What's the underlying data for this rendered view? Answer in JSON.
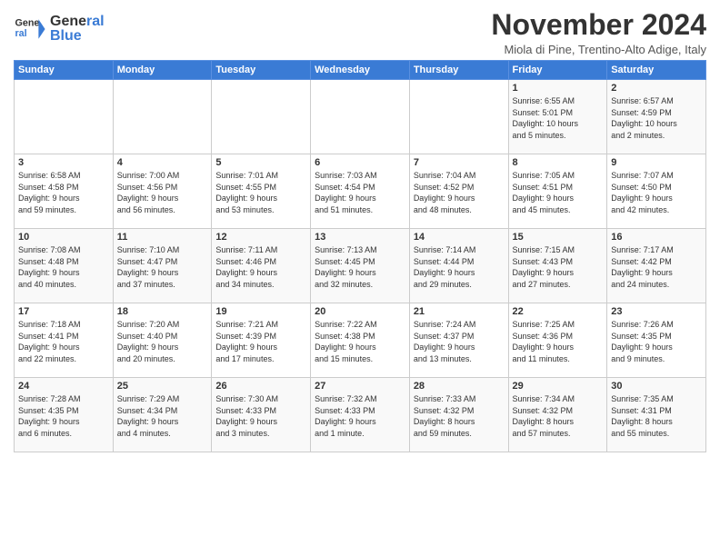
{
  "header": {
    "title": "November 2024",
    "location": "Miola di Pine, Trentino-Alto Adige, Italy",
    "logo_line1": "General",
    "logo_line2": "Blue"
  },
  "weekdays": [
    "Sunday",
    "Monday",
    "Tuesday",
    "Wednesday",
    "Thursday",
    "Friday",
    "Saturday"
  ],
  "weeks": [
    [
      {
        "day": "",
        "info": ""
      },
      {
        "day": "",
        "info": ""
      },
      {
        "day": "",
        "info": ""
      },
      {
        "day": "",
        "info": ""
      },
      {
        "day": "",
        "info": ""
      },
      {
        "day": "1",
        "info": "Sunrise: 6:55 AM\nSunset: 5:01 PM\nDaylight: 10 hours\nand 5 minutes."
      },
      {
        "day": "2",
        "info": "Sunrise: 6:57 AM\nSunset: 4:59 PM\nDaylight: 10 hours\nand 2 minutes."
      }
    ],
    [
      {
        "day": "3",
        "info": "Sunrise: 6:58 AM\nSunset: 4:58 PM\nDaylight: 9 hours\nand 59 minutes."
      },
      {
        "day": "4",
        "info": "Sunrise: 7:00 AM\nSunset: 4:56 PM\nDaylight: 9 hours\nand 56 minutes."
      },
      {
        "day": "5",
        "info": "Sunrise: 7:01 AM\nSunset: 4:55 PM\nDaylight: 9 hours\nand 53 minutes."
      },
      {
        "day": "6",
        "info": "Sunrise: 7:03 AM\nSunset: 4:54 PM\nDaylight: 9 hours\nand 51 minutes."
      },
      {
        "day": "7",
        "info": "Sunrise: 7:04 AM\nSunset: 4:52 PM\nDaylight: 9 hours\nand 48 minutes."
      },
      {
        "day": "8",
        "info": "Sunrise: 7:05 AM\nSunset: 4:51 PM\nDaylight: 9 hours\nand 45 minutes."
      },
      {
        "day": "9",
        "info": "Sunrise: 7:07 AM\nSunset: 4:50 PM\nDaylight: 9 hours\nand 42 minutes."
      }
    ],
    [
      {
        "day": "10",
        "info": "Sunrise: 7:08 AM\nSunset: 4:48 PM\nDaylight: 9 hours\nand 40 minutes."
      },
      {
        "day": "11",
        "info": "Sunrise: 7:10 AM\nSunset: 4:47 PM\nDaylight: 9 hours\nand 37 minutes."
      },
      {
        "day": "12",
        "info": "Sunrise: 7:11 AM\nSunset: 4:46 PM\nDaylight: 9 hours\nand 34 minutes."
      },
      {
        "day": "13",
        "info": "Sunrise: 7:13 AM\nSunset: 4:45 PM\nDaylight: 9 hours\nand 32 minutes."
      },
      {
        "day": "14",
        "info": "Sunrise: 7:14 AM\nSunset: 4:44 PM\nDaylight: 9 hours\nand 29 minutes."
      },
      {
        "day": "15",
        "info": "Sunrise: 7:15 AM\nSunset: 4:43 PM\nDaylight: 9 hours\nand 27 minutes."
      },
      {
        "day": "16",
        "info": "Sunrise: 7:17 AM\nSunset: 4:42 PM\nDaylight: 9 hours\nand 24 minutes."
      }
    ],
    [
      {
        "day": "17",
        "info": "Sunrise: 7:18 AM\nSunset: 4:41 PM\nDaylight: 9 hours\nand 22 minutes."
      },
      {
        "day": "18",
        "info": "Sunrise: 7:20 AM\nSunset: 4:40 PM\nDaylight: 9 hours\nand 20 minutes."
      },
      {
        "day": "19",
        "info": "Sunrise: 7:21 AM\nSunset: 4:39 PM\nDaylight: 9 hours\nand 17 minutes."
      },
      {
        "day": "20",
        "info": "Sunrise: 7:22 AM\nSunset: 4:38 PM\nDaylight: 9 hours\nand 15 minutes."
      },
      {
        "day": "21",
        "info": "Sunrise: 7:24 AM\nSunset: 4:37 PM\nDaylight: 9 hours\nand 13 minutes."
      },
      {
        "day": "22",
        "info": "Sunrise: 7:25 AM\nSunset: 4:36 PM\nDaylight: 9 hours\nand 11 minutes."
      },
      {
        "day": "23",
        "info": "Sunrise: 7:26 AM\nSunset: 4:35 PM\nDaylight: 9 hours\nand 9 minutes."
      }
    ],
    [
      {
        "day": "24",
        "info": "Sunrise: 7:28 AM\nSunset: 4:35 PM\nDaylight: 9 hours\nand 6 minutes."
      },
      {
        "day": "25",
        "info": "Sunrise: 7:29 AM\nSunset: 4:34 PM\nDaylight: 9 hours\nand 4 minutes."
      },
      {
        "day": "26",
        "info": "Sunrise: 7:30 AM\nSunset: 4:33 PM\nDaylight: 9 hours\nand 3 minutes."
      },
      {
        "day": "27",
        "info": "Sunrise: 7:32 AM\nSunset: 4:33 PM\nDaylight: 9 hours\nand 1 minute."
      },
      {
        "day": "28",
        "info": "Sunrise: 7:33 AM\nSunset: 4:32 PM\nDaylight: 8 hours\nand 59 minutes."
      },
      {
        "day": "29",
        "info": "Sunrise: 7:34 AM\nSunset: 4:32 PM\nDaylight: 8 hours\nand 57 minutes."
      },
      {
        "day": "30",
        "info": "Sunrise: 7:35 AM\nSunset: 4:31 PM\nDaylight: 8 hours\nand 55 minutes."
      }
    ]
  ]
}
